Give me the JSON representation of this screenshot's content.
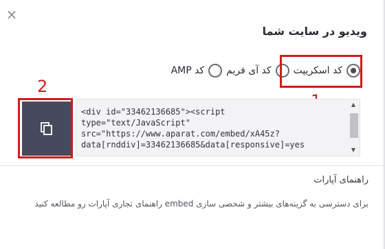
{
  "modal": {
    "close_glyph": "×",
    "title": "ویدیو در سایت شما"
  },
  "embed_options": [
    {
      "label": "کد اسکریپت",
      "checked": true
    },
    {
      "label": "کد آی فریم",
      "checked": false
    },
    {
      "label": "کد AMP",
      "checked": false
    }
  ],
  "annotations": {
    "marker_1": "1",
    "marker_2": "2",
    "highlight_color": "#d11b1b"
  },
  "code": {
    "lines": [
      "<div id=\"33462136685\"><script",
      "type=\"text/JavaScript\"",
      "src=\"https://www.aparat.com/embed/xA45z?",
      "data[rnddiv]=33462136685&data[responsive]=yes"
    ],
    "copy_icon": "copy-icon"
  },
  "guide": {
    "title": "راهنمای آپارات",
    "text": "برای دسترسی به گزینه‌های بیشتر و شخصی سازی embed راهنمای تجاری آپارات رو مطالعه کنید"
  }
}
